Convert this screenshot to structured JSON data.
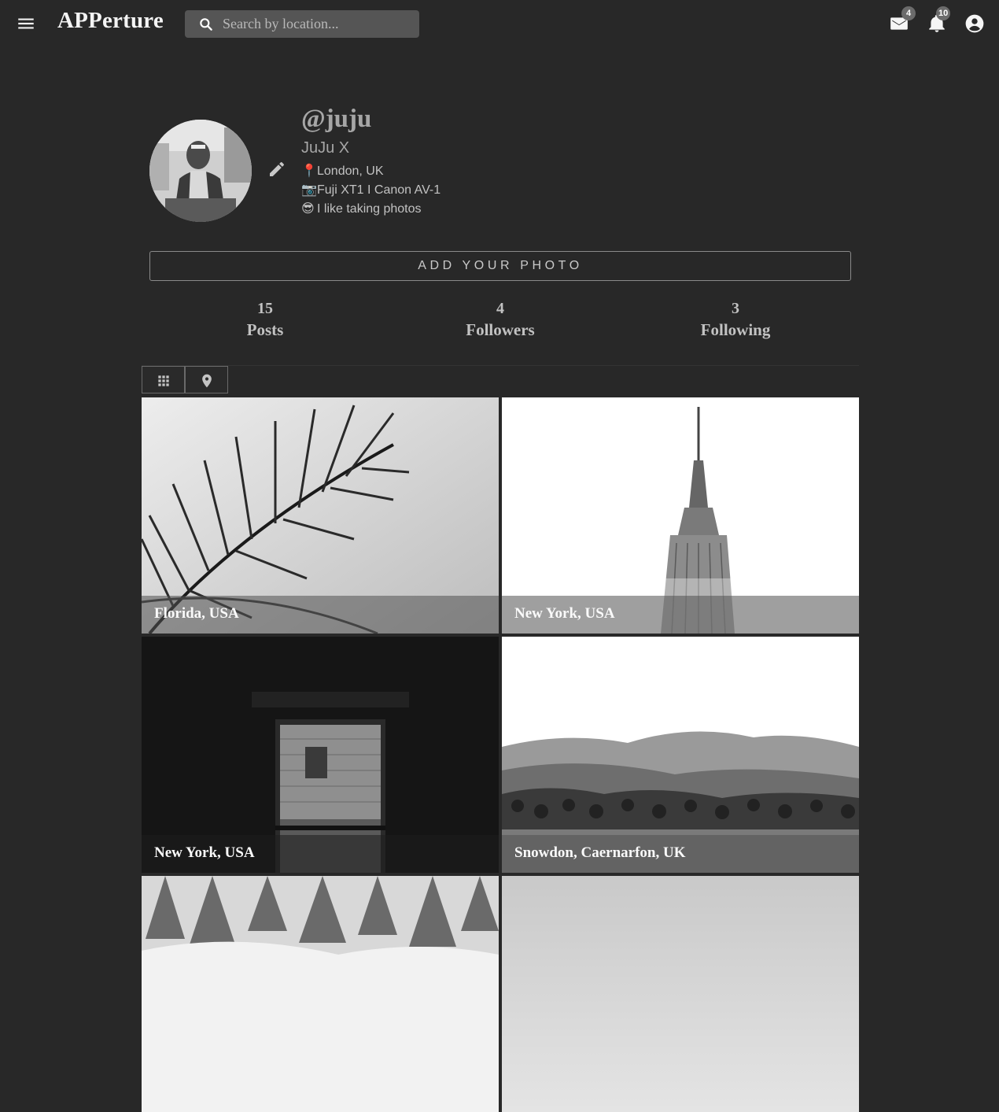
{
  "header": {
    "brand": "APPerture",
    "search_placeholder": "Search by location...",
    "messages_count": "4",
    "notifications_count": "10",
    "icons": [
      "menu-icon",
      "search-icon",
      "mail-icon",
      "bell-icon",
      "account-icon"
    ]
  },
  "profile": {
    "username": "@juju",
    "full_name": "JuJu X",
    "bio": [
      {
        "emoji": "📍",
        "text": "London, UK"
      },
      {
        "emoji": "📷",
        "text": "Fuji XT1 I Canon AV-1"
      },
      {
        "emoji": "😎",
        "text": "I like taking photos"
      }
    ],
    "add_photo_label": "ADD YOUR PHOTO"
  },
  "stats": [
    {
      "value": "15",
      "label": "Posts"
    },
    {
      "value": "4",
      "label": "Followers"
    },
    {
      "value": "3",
      "label": "Following"
    }
  ],
  "view_tabs": [
    "grid-view-icon",
    "map-view-icon"
  ],
  "photos": [
    {
      "location": "Florida, USA"
    },
    {
      "location": "New York, USA"
    },
    {
      "location": "New York, USA"
    },
    {
      "location": "Snowdon, Caernarfon, UK"
    },
    {
      "location": ""
    },
    {
      "location": ""
    }
  ],
  "colors": {
    "background": "#282828",
    "search_bg": "#555555",
    "badge": "#6b6b6b",
    "text_muted": "#a6a6a6"
  }
}
